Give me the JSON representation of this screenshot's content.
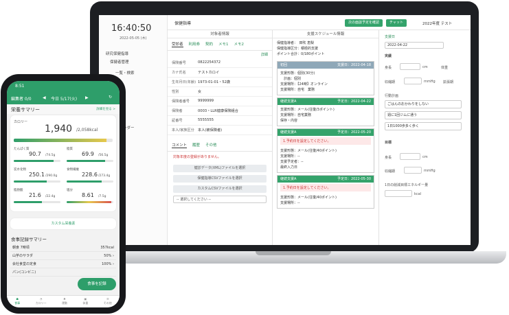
{
  "laptop": {
    "clock": "16:40:50",
    "clock_date": "2022-05-05 (木)",
    "sidebar": [
      "研究保健指導",
      "保健者管理",
      "一覧・検索",
      "カレンダー"
    ],
    "top_title": "保健指導",
    "btn_meeting": "次の面談予定を確認",
    "btn_chat": "チャット",
    "year_label": "2022年度 テスト",
    "subject": {
      "header": "対象者情報",
      "tabs": [
        "受診者",
        "利用券",
        "契約",
        "メモ1",
        "メモ2"
      ],
      "edit": "詳細",
      "fields": [
        {
          "k": "保険番号",
          "v": "0822254372"
        },
        {
          "k": "カナ氏名",
          "v": "テストカロイ"
        },
        {
          "k": "生年月日(年齢)",
          "v": "1973-01-01・52歳"
        },
        {
          "k": "性別",
          "v": "女"
        },
        {
          "k": "保険者番号",
          "v": "9999999"
        },
        {
          "k": "保険者",
          "v": "0003・LLR健康保険組合"
        },
        {
          "k": "証番号",
          "v": "5555555"
        },
        {
          "k": "本人/家族区分",
          "v": "本人(被保険者)"
        }
      ],
      "tabs2": [
        "コメント",
        "履歴",
        "その他"
      ],
      "no_files": "対象年度の登録がありません。",
      "uploads": [
        "健診データ(XML)ファイルを選択",
        "保健指導CSVファイルを選択",
        "カスタムCSVファイルを選択"
      ],
      "select_ph": "-- 選択してください --"
    },
    "schedule": {
      "header": "支援スケジュール情報",
      "lines": [
        "保健指導者：　田吹 恵梨",
        "保健指導区分：積極的支援",
        "ポイント合計：0/180ポイント"
      ],
      "blocks": [
        {
          "title": "初回",
          "date": "支援日：2022-04-18",
          "color": "#8fa8b8",
          "lines": [
            "支援形態：個別(30分)",
            "　計画：個別",
            "支援場所：【24時】オンライン",
            "支援場所：自宅　業務"
          ]
        },
        {
          "title": "継続支援A",
          "date": "予定日：2022-04-22",
          "color": "#34a36b",
          "lines": [
            "支援形態：メール(往復/3ポイント)",
            "支援場所：自宅業務",
            "保存・内容"
          ]
        },
        {
          "title": "継続支援A",
          "date": "予定日：2022-05-20",
          "color": "#34a36b",
          "warn": "1.予約日を設定してください。",
          "lines": [
            "支援形態：メール(往復/40ポイント)",
            "支援場所：--",
            "支援予定者：--",
            "最終入力日"
          ]
        },
        {
          "title": "継続支援A",
          "date": "予定日：2022-05-30",
          "color": "#34a36b",
          "warn": "1.予約日を設定してください。",
          "lines": [
            "支援形態：メール(往復/40ポイント)",
            "支援場所：--"
          ]
        }
      ]
    },
    "right": {
      "date_label": "支援日",
      "date_value": "2022-04-22",
      "jisseki": "実績",
      "fields": [
        "身長",
        "体重",
        "収縮期",
        "拡張期"
      ],
      "units": [
        "cm",
        "kg",
        "mmHg"
      ],
      "sec2": "行動計画",
      "goals": [
        "ごはんのおかわりをしない",
        "週に1回ジムに通う",
        "1日1000歩多く歩く"
      ],
      "sec3": "目標",
      "calorie_lbl": "1日の削減目標エネルギー量",
      "kcal": "kcal"
    }
  },
  "phone": {
    "time": "8:51",
    "nav_left": "編集者 0/0",
    "nav_date": "今日 5/17(火)",
    "summary_title": "栄養サマリー",
    "summary_link": "詳細を見る >",
    "calorie_label": "カロリー",
    "calorie_value": "1,940",
    "calorie_target": "/2,058kcal",
    "nutrients": [
      {
        "name": "たんぱく質",
        "val": "90.7",
        "unit": "/74.5g",
        "pct": 0.85
      },
      {
        "name": "脂質",
        "val": "69.9",
        "unit": "/56.5g",
        "pct": 0.82
      },
      {
        "name": "炭水化物",
        "val": "250.1",
        "unit": "/290.0g",
        "pct": 0.7
      },
      {
        "name": "食物繊維",
        "val": "228.6",
        "unit": "/273.4g",
        "pct": 0.75
      },
      {
        "name": "脂肪酸",
        "val": "21.6",
        "unit": "/22.4g",
        "pct": 0.6
      },
      {
        "name": "塩分",
        "val": "8.61",
        "unit": "/7.5g",
        "pct": 0.95
      }
    ],
    "custom_btn": "カスタム栄養素",
    "meal_title": "食事記録サマリー",
    "meal_rows": [
      {
        "k": "朝食 7時頃",
        "v": "357kcal"
      },
      {
        "k": "山芋のサラダ",
        "v": "50% ›"
      },
      {
        "k": "会社食堂の定食",
        "v": "100% ›"
      },
      {
        "k": "パン(コンビニ)",
        "v": ""
      }
    ],
    "fab": "食事を記録",
    "tabs": [
      "食事",
      "カロリー",
      "運動",
      "体重",
      "その他"
    ]
  },
  "colors": {
    "accent": "#2e9e6a",
    "dark": "#1d1f23"
  }
}
